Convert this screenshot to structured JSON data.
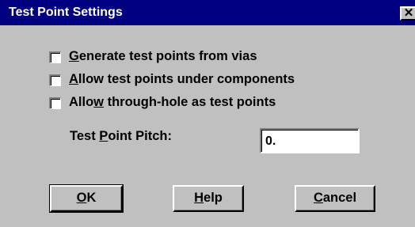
{
  "dialog": {
    "title": "Test Point Settings",
    "close_glyph": "✕"
  },
  "options": [
    {
      "pre": "",
      "mnemonic": "G",
      "post": "enerate test points from vias",
      "checked": false
    },
    {
      "pre": "",
      "mnemonic": "A",
      "post": "llow test points under components",
      "checked": false
    },
    {
      "pre": "Allo",
      "mnemonic": "w",
      "post": " through-hole as test points",
      "checked": false
    }
  ],
  "pitch": {
    "label_pre": "Test ",
    "label_mnemonic": "P",
    "label_post": "oint Pitch:",
    "value": "0."
  },
  "buttons": {
    "ok": {
      "mnemonic": "O",
      "rest": "K"
    },
    "help": {
      "mnemonic": "H",
      "rest": "elp"
    },
    "cancel": {
      "mnemonic": "C",
      "rest": "ancel"
    }
  }
}
